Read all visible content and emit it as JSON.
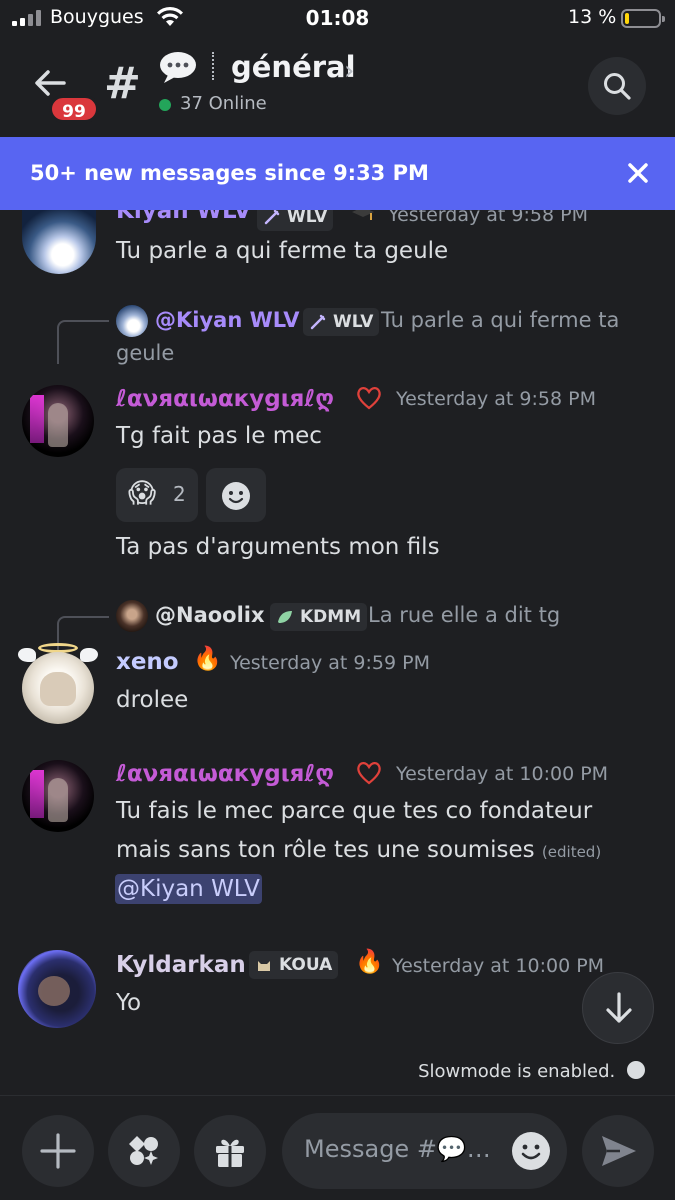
{
  "status_bar": {
    "carrier": "Bouygues",
    "time": "01:08",
    "battery": "13 %"
  },
  "header": {
    "unread_count": "99",
    "channel_name": "général",
    "online": "37 Online"
  },
  "banner": {
    "text": "50+ new messages since 9:33 PM"
  },
  "messages": [
    {
      "author": "Kiyan WLV",
      "tag": "WLV",
      "timestamp": "Yesterday at 9:58 PM",
      "lines": [
        "Tu parle a qui ferme ta geule"
      ]
    },
    {
      "reply": {
        "name": "@Kiyan WLV",
        "tag": "WLV",
        "text_1": "Tu parle a qui ferme ta",
        "text_2": "geule"
      },
      "author": "ℓανяαιωαкуgιяℓღ",
      "timestamp": "Yesterday at 9:58 PM",
      "lines": [
        "Tg fait  pas le mec"
      ],
      "reaction": {
        "emoji": "😱",
        "count": "2"
      },
      "followup": "Ta pas d'arguments  mon fils"
    },
    {
      "reply": {
        "name": "@Naoolix",
        "tag": "KDMM",
        "text": "La rue elle a dit tg"
      },
      "author": "xeno",
      "timestamp": "Yesterday at 9:59 PM",
      "lines": [
        "drolee"
      ]
    },
    {
      "author": "ℓανяαιωαкуgιяℓღ",
      "timestamp": "Yesterday at 10:00 PM",
      "lines": [
        "Tu fais le mec parce que tes co fondateur",
        "mais sans ton rôle tes une soumises"
      ],
      "edited": "(edited)",
      "mention": "@Kiyan WLV"
    },
    {
      "author": "Kyldarkan",
      "tag": "KOUA",
      "timestamp": "Yesterday at 10:00 PM",
      "lines": [
        "Yo"
      ]
    }
  ],
  "slowmode": "Slowmode is enabled.",
  "composer": {
    "placeholder": "Message #💬…"
  },
  "colors": {
    "accent": "#5865f2",
    "background": "#1e1f22",
    "kiyan_name": "#a78bfa",
    "girl_name": "#c45bd6",
    "xeno_name": "#c4cbff",
    "kyldarkan_name": "#d8cfe8"
  }
}
